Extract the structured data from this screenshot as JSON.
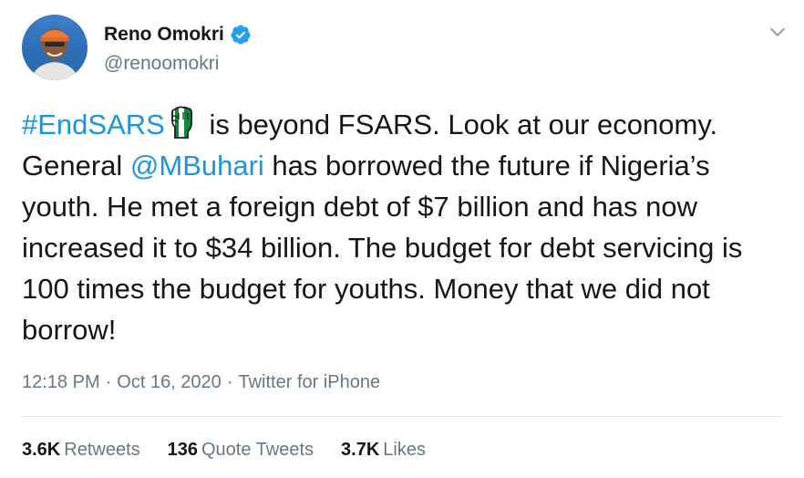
{
  "author": {
    "display_name": "Reno Omokri",
    "handle": "@renoomokri",
    "verified": true
  },
  "tweet": {
    "hashtag": "#EndSARS",
    "segment_1": " is beyond FSARS. Look at our economy. General ",
    "mention": "@MBuhari",
    "segment_2": " has borrowed the future if Nigeria’s youth. He met a foreign debt of $7 billion and has now increased it to $34 billion. The budget for debt servicing is 100 times the budget for youths. Money that we did not borrow!",
    "emoji": "raised-fist-nigeria-flag"
  },
  "meta": {
    "time": "12:18 PM",
    "separator_1": "·",
    "date": "Oct 16, 2020",
    "separator_2": "·",
    "source": "Twitter for iPhone"
  },
  "stats": {
    "retweets_count": "3.6K",
    "retweets_label": "Retweets",
    "quotes_count": "136",
    "quotes_label": "Quote Tweets",
    "likes_count": "3.7K",
    "likes_label": "Likes"
  },
  "colors": {
    "link": "#1b95e0",
    "secondary_text": "#657786",
    "primary_text": "#14171a",
    "divider": "#e1e8ed",
    "verified_badge": "#1da1f2"
  }
}
